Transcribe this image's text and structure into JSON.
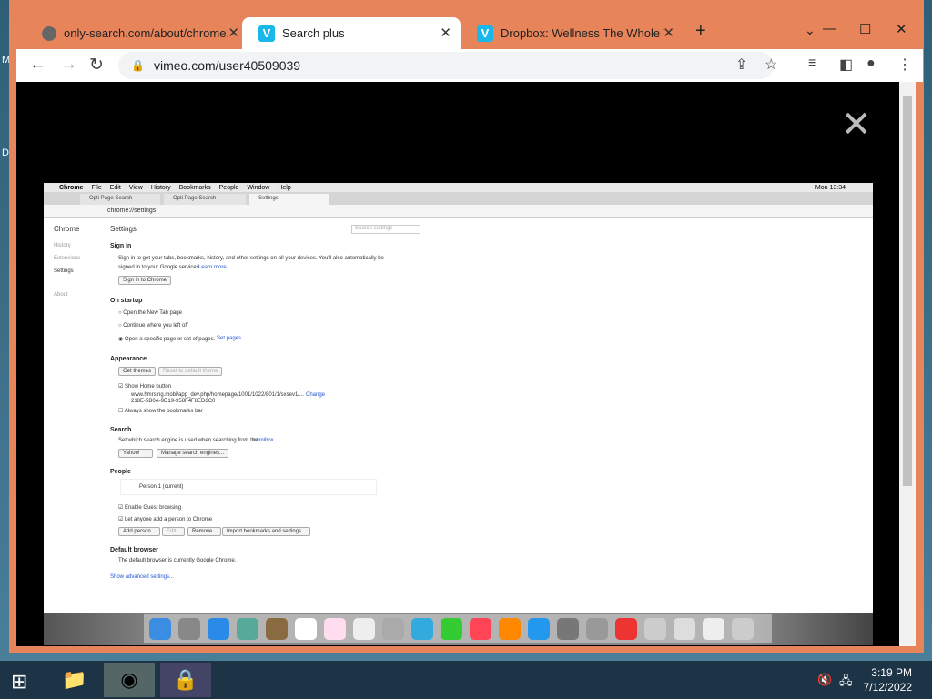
{
  "browser": {
    "tabs": [
      {
        "title": "only-search.com/about/chrome.h",
        "icon": "globe-icon"
      },
      {
        "title": "Search plus",
        "icon": "vimeo-icon"
      },
      {
        "title": "Dropbox: Wellness The Whole Ti",
        "icon": "vimeo-icon"
      }
    ],
    "url": "vimeo.com/user40509039",
    "window_controls": [
      "—",
      "☐",
      "✕"
    ]
  },
  "inner": {
    "menubar": [
      "Chrome",
      "File",
      "Edit",
      "View",
      "History",
      "Bookmarks",
      "People",
      "Window",
      "Help"
    ],
    "clock": "Mon 13:34",
    "tabs": [
      "Opti Page Search",
      "Opti Page Search",
      "Settings"
    ],
    "url": "chrome://settings",
    "sidebar": {
      "title": "Chrome",
      "items": [
        "History",
        "Extensions",
        "Settings",
        "About"
      ]
    },
    "settings": {
      "title": "Settings",
      "search_placeholder": "Search settings",
      "signin_h": "Sign in",
      "signin_text1": "Sign in to get your tabs, bookmarks, history, and other settings on all your devices. You'll also automatically be",
      "signin_text2": "signed in to your Google services.",
      "learn_more": "Learn more",
      "signin_btn": "Sign in to Chrome",
      "startup_h": "On startup",
      "startup_opts": [
        "Open the New Tab page",
        "Continue where you left off",
        "Open a specific page or set of pages."
      ],
      "set_pages": "Set pages",
      "appearance_h": "Appearance",
      "get_themes": "Get themes",
      "reset_theme": "Reset to default theme",
      "show_home": "Show Home button",
      "home_url1": "www.hmrsing.mobi/app_dev.php/homepage/1001/1022/801/1/sxsev1/...",
      "change": "Change",
      "home_url2": "218E-5B0A-9D19-958F4F8ED6C0",
      "bookmarks_bar": "Always show the bookmarks bar",
      "search_h": "Search",
      "search_text": "Set which search engine is used when searching from the",
      "omnibox": "omnibox",
      "engine": "Yahoo!",
      "manage_engines": "Manage search engines...",
      "people_h": "People",
      "person": "Person 1 (current)",
      "guest": "Enable Guest browsing",
      "add_anyone": "Let anyone add a person to Chrome",
      "people_btns": [
        "Add person...",
        "Edit...",
        "Remove...",
        "Import bookmarks and settings..."
      ],
      "default_h": "Default browser",
      "default_text": "The default browser is currently Google Chrome.",
      "advanced": "Show advanced settings..."
    }
  },
  "taskbar": {
    "time": "3:19 PM",
    "date": "7/12/2022"
  },
  "colors": {
    "window_frame": "#e8845a",
    "accent": "#1ab7ea"
  }
}
